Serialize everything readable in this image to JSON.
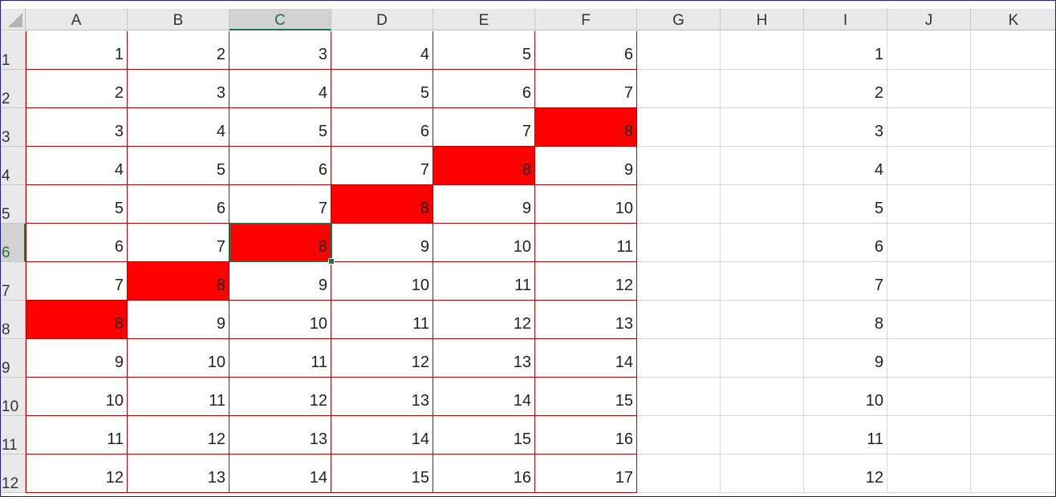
{
  "sheet": {
    "columns": [
      "A",
      "B",
      "C",
      "D",
      "E",
      "F",
      "G",
      "H",
      "I",
      "J",
      "K"
    ],
    "rows": [
      "1",
      "2",
      "3",
      "4",
      "5",
      "6",
      "7",
      "8",
      "9",
      "10",
      "11",
      "12"
    ],
    "active_cell": "C6",
    "table_values": [
      [
        "1",
        "2",
        "3",
        "4",
        "5",
        "6"
      ],
      [
        "2",
        "3",
        "4",
        "5",
        "6",
        "7"
      ],
      [
        "3",
        "4",
        "5",
        "6",
        "7",
        "8"
      ],
      [
        "4",
        "5",
        "6",
        "7",
        "8",
        "9"
      ],
      [
        "5",
        "6",
        "7",
        "8",
        "9",
        "10"
      ],
      [
        "6",
        "7",
        "8",
        "9",
        "10",
        "11"
      ],
      [
        "7",
        "8",
        "9",
        "10",
        "11",
        "12"
      ],
      [
        "8",
        "9",
        "10",
        "11",
        "12",
        "13"
      ],
      [
        "9",
        "10",
        "11",
        "12",
        "13",
        "14"
      ],
      [
        "10",
        "11",
        "12",
        "13",
        "14",
        "15"
      ],
      [
        "11",
        "12",
        "13",
        "14",
        "15",
        "16"
      ],
      [
        "12",
        "13",
        "14",
        "15",
        "16",
        "17"
      ]
    ],
    "column_I_values": [
      "1",
      "2",
      "3",
      "4",
      "5",
      "6",
      "7",
      "8",
      "9",
      "10",
      "11",
      "12"
    ],
    "highlighted_cells": [
      "F3",
      "E4",
      "D5",
      "C6",
      "B7",
      "A8"
    ],
    "highlight_value": "8",
    "colors": {
      "highlight_fill": "#ff0000",
      "table_border": "#c00000",
      "selection": "#217346"
    }
  }
}
